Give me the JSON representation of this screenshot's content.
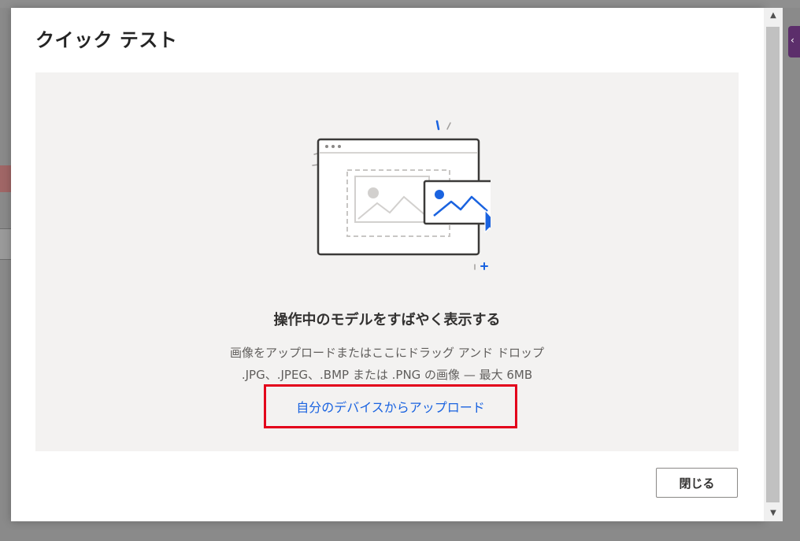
{
  "dialog": {
    "title": "クイック テスト",
    "heading": "操作中のモデルをすばやく表示する",
    "instruction_line1": "画像をアップロードまたはここにドラッグ アンド ドロップ",
    "instruction_line2": ".JPG、.JPEG、.BMP または .PNG の画像 — 最大 6MB",
    "upload_link": "自分のデバイスからアップロード",
    "close_label": "閉じる"
  },
  "colors": {
    "accent_blue": "#1a63e0",
    "highlight_red": "#e3001b",
    "drop_zone_bg": "#f3f2f1"
  },
  "icons": {
    "illustration": "image-upload-illustration",
    "scroll_up": "scroll-up-arrow-icon",
    "scroll_down": "scroll-down-arrow-icon"
  }
}
